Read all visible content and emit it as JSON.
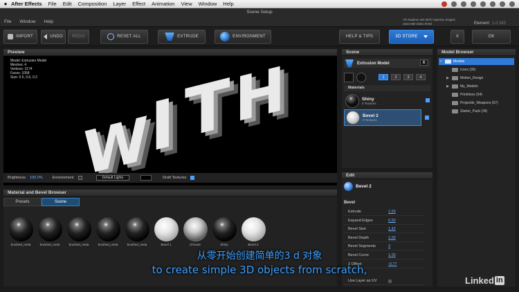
{
  "mac_menu": {
    "apple": "",
    "app_name": "After Effects",
    "items": [
      "File",
      "Edit",
      "Composition",
      "Layer",
      "Effect",
      "Animation",
      "View",
      "Window",
      "Help"
    ]
  },
  "window": {
    "title": "Scene Setup",
    "menus": [
      "File",
      "Window",
      "Help"
    ],
    "gpu_line1": "ATI Radeon HD 5870 OpenGL Engine",
    "gpu_line2": "1024 MB Video RAM",
    "product": "Element",
    "version": "1.0.345"
  },
  "toolbar": {
    "import": "IMPORT",
    "undo": "UNDO",
    "redo": "REDO",
    "reset_all": "RESET ALL",
    "extrude": "EXTRUDE",
    "environment": "ENVIRONMENT",
    "help_tips": "HELP & TIPS",
    "store": "3D STORE",
    "close": "X",
    "ok": "OK"
  },
  "preview": {
    "header": "Preview",
    "stats": [
      "Model: Extrusion Model",
      "Meshes: 4",
      "Vertices: 3174",
      "Faces: 1058",
      "Size: 0.5, 0.6, 0.2"
    ],
    "scene_text": [
      "W",
      "I",
      "T",
      "H"
    ],
    "brightness_label": "Brightness",
    "brightness_value": "100.0%",
    "environment_label": "Environment",
    "lights_value": "Default Lights",
    "draft_label": "Draft Textures"
  },
  "material_browser": {
    "header": "Material and Bevel Browser",
    "tabs": [
      "Presets",
      "Scene"
    ],
    "items": [
      {
        "label": "brushed_meta",
        "style": "dark"
      },
      {
        "label": "brushed_meta",
        "style": "dark"
      },
      {
        "label": "brushed_meta",
        "style": "dark"
      },
      {
        "label": "brushed_meta",
        "style": "dark"
      },
      {
        "label": "brushed_meta",
        "style": "dark"
      },
      {
        "label": "Bevel 1",
        "style": "light"
      },
      {
        "label": "Chrome",
        "style": "chrome"
      },
      {
        "label": "Shiny",
        "style": "dark"
      },
      {
        "label": "Bevel 2",
        "style": "light"
      }
    ]
  },
  "scene": {
    "header": "Scene",
    "model_name": "Extrusion Model",
    "close": "X",
    "groups": [
      "1",
      "2",
      "3",
      "4"
    ],
    "materials_header": "Materials",
    "materials": [
      {
        "name": "Shiny",
        "sub": "0 Textures"
      },
      {
        "name": "Bevel 2",
        "sub": "0 Textures"
      }
    ]
  },
  "edit": {
    "header": "Edit",
    "material": "Bevel 2",
    "section": "Bevel",
    "props": [
      {
        "label": "Extrude",
        "value": "1.63"
      },
      {
        "label": "Expand Edges",
        "value": "0.50"
      },
      {
        "label": "Bevel Size",
        "value": "1.42"
      },
      {
        "label": "Bevel Depth",
        "value": "1.00"
      },
      {
        "label": "Bevel Segments",
        "value": "3"
      },
      {
        "label": "Bevel Curve",
        "value": "1.00"
      },
      {
        "label": "Z Offset",
        "value": "-0.77"
      },
      {
        "label": "Use Layer as UV",
        "value": ""
      }
    ]
  },
  "model_browser": {
    "header": "Model Browser",
    "items": [
      {
        "label": "Models",
        "indent": 0,
        "arrow": "▼",
        "active": true
      },
      {
        "label": "Icons (30)",
        "indent": 1,
        "arrow": "",
        "active": false
      },
      {
        "label": "Motion_Design",
        "indent": 1,
        "arrow": "▶",
        "active": false
      },
      {
        "label": "My_Models",
        "indent": 1,
        "arrow": "▶",
        "active": false
      },
      {
        "label": "Primitives (54)",
        "indent": 1,
        "arrow": "",
        "active": false
      },
      {
        "label": "Projectile_Weapons (57)",
        "indent": 1,
        "arrow": "",
        "active": false
      },
      {
        "label": "Starter_Pack (34)",
        "indent": 1,
        "arrow": "",
        "active": false
      }
    ]
  },
  "subtitles": {
    "chinese": "从零开始创建简单的3 d 对象",
    "english": "to create simple 3D objects from scratch,"
  },
  "watermark": {
    "text": "Linked",
    "badge": "in"
  },
  "colors": {
    "accent_blue": "#2f7bd8",
    "subtitle_blue": "#3ea0ff",
    "value_blue": "#6fb0ff"
  }
}
